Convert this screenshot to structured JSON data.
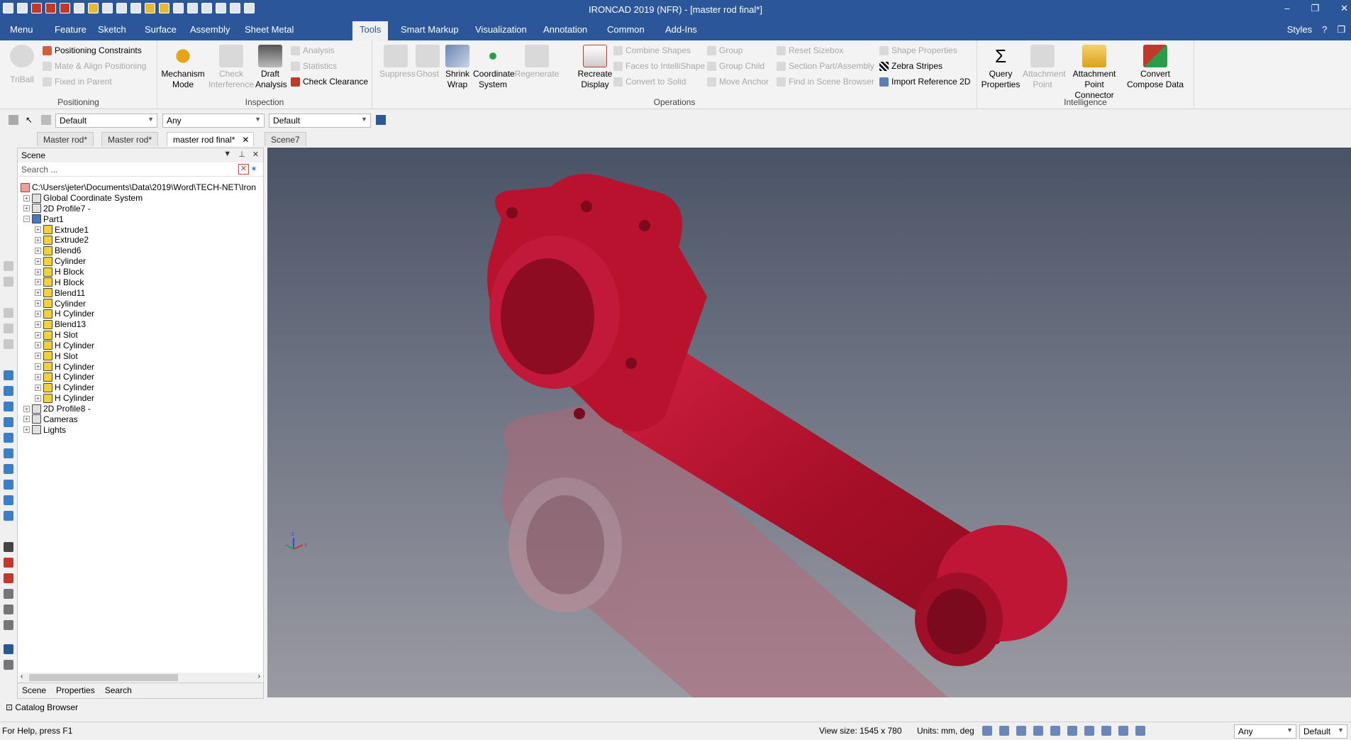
{
  "app": {
    "title": "IRONCAD 2019 (NFR) - [master rod final*]",
    "window_controls": [
      "–",
      "❐",
      "✕"
    ]
  },
  "menu": {
    "tabs": [
      "Menu",
      "Feature",
      "Sketch",
      "Surface",
      "Assembly",
      "Sheet Metal",
      "Tools",
      "Smart Markup",
      "Visualization",
      "Annotation",
      "Common",
      "Add-Ins"
    ],
    "active": "Tools",
    "styles_label": "Styles"
  },
  "ribbon": {
    "positioning": {
      "label": "Positioning",
      "triball": "TriBall",
      "positioning_constraints": "Positioning Constraints",
      "mate_align": "Mate & Align Positioning",
      "fixed_in_parent": "Fixed in Parent"
    },
    "inspection": {
      "label": "Inspection",
      "mechanism_mode": "Mechanism Mode",
      "check_interference": "Check Interference",
      "draft_analysis": "Draft Analysis",
      "analysis": "Analysis",
      "statistics": "Statistics",
      "check_clearance": "Check Clearance"
    },
    "operations": {
      "label": "Operations",
      "suppress": "Suppress",
      "ghost": "Ghost",
      "shrink_wrap": "Shrink Wrap",
      "coordinate_system": "Coordinate System",
      "regenerate": "Regenerate",
      "recreate_display": "Recreate Display",
      "combine_shapes": "Combine Shapes",
      "faces_to_intellishape": "Faces to IntelliShape",
      "convert_to_solid": "Convert to Solid",
      "group": "Group",
      "group_child": "Group Child",
      "move_anchor": "Move Anchor",
      "reset_sizebox": "Reset Sizebox",
      "section_part": "Section Part/Assembly",
      "find_in_scene": "Find in Scene Browser",
      "shape_properties": "Shape Properties",
      "zebra_stripes": "Zebra Stripes",
      "import_reference": "Import Reference 2D"
    },
    "intelligence": {
      "label": "Intelligence",
      "query_properties": "Query Properties",
      "attachment_point": "Attachment Point",
      "attachment_point_connector": "Attachment Point Connector",
      "convert_compose_data": "Convert Compose Data"
    }
  },
  "filters": {
    "style": "Default",
    "selection": "Any",
    "layer": "Default"
  },
  "doc_tabs": [
    "Master rod*",
    "Master rod*",
    "master rod final*",
    "Scene7"
  ],
  "scene": {
    "title": "Scene",
    "search_placeholder": "Search ...",
    "path": "C:\\Users\\jeter\\Documents\\Data\\2019\\Word\\TECH-NET\\Iron",
    "nodes": [
      {
        "label": "Global Coordinate System",
        "level": 1
      },
      {
        "label": "2D Profile7 -",
        "level": 1
      },
      {
        "label": "Part1",
        "level": 1
      },
      {
        "label": "Extrude1",
        "level": 2
      },
      {
        "label": "Extrude2",
        "level": 2
      },
      {
        "label": "Blend6",
        "level": 2
      },
      {
        "label": "Cylinder",
        "level": 2
      },
      {
        "label": "H Block",
        "level": 2
      },
      {
        "label": "H Block",
        "level": 2
      },
      {
        "label": "Blend11",
        "level": 2
      },
      {
        "label": "Cylinder",
        "level": 2
      },
      {
        "label": "H Cylinder",
        "level": 2
      },
      {
        "label": "Blend13",
        "level": 2
      },
      {
        "label": "H Slot",
        "level": 2
      },
      {
        "label": "H Cylinder",
        "level": 2
      },
      {
        "label": "H Slot",
        "level": 2
      },
      {
        "label": "H Cylinder",
        "level": 2
      },
      {
        "label": "H Cylinder",
        "level": 2
      },
      {
        "label": "H Cylinder",
        "level": 2
      },
      {
        "label": "H Cylinder",
        "level": 2
      },
      {
        "label": "2D Profile8 -",
        "level": 1
      },
      {
        "label": "Cameras",
        "level": 1
      },
      {
        "label": "Lights",
        "level": 1
      }
    ],
    "bottom_tabs": [
      "Scene",
      "Properties",
      "Search"
    ]
  },
  "catalog": "Catalog Browser",
  "status": {
    "help": "For Help, press F1",
    "view_size": "View size: 1545 x 780",
    "units": "Units: mm, deg",
    "filter": "Any",
    "style": "Default"
  },
  "colors": {
    "title_bar": "#2b579a",
    "model": "#b0122e",
    "model_shadow": "#b26878"
  }
}
